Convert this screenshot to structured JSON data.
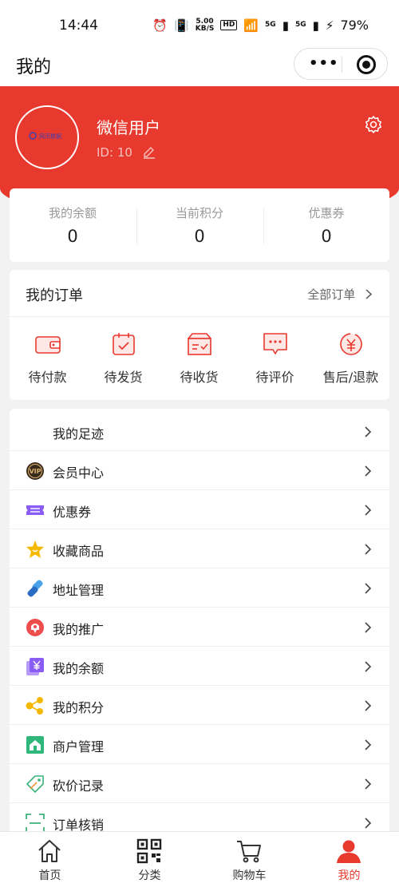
{
  "status_bar": {
    "time": "14:44",
    "net_speed_top": "5.00",
    "net_speed_bottom": "KB/S",
    "hd": "HD",
    "signal1": "5G",
    "signal2": "5G",
    "battery": "79%"
  },
  "nav": {
    "title": "我的",
    "menu_icon": "more-dots-icon",
    "close_icon": "target-icon"
  },
  "profile": {
    "name": "微信用户",
    "id_label": "ID:",
    "id_value": "10",
    "avatar_text": "网页数据",
    "accent_color": "#e8392f"
  },
  "balance": [
    {
      "label": "我的余额",
      "value": "0"
    },
    {
      "label": "当前积分",
      "value": "0"
    },
    {
      "label": "优惠券",
      "value": "0"
    }
  ],
  "orders": {
    "title": "我的订单",
    "all_label": "全部订单",
    "items": [
      {
        "label": "待付款",
        "icon": "wallet-icon"
      },
      {
        "label": "待发货",
        "icon": "calendar-check-icon"
      },
      {
        "label": "待收货",
        "icon": "box-icon"
      },
      {
        "label": "待评价",
        "icon": "comment-icon"
      },
      {
        "label": "售后/退款",
        "icon": "refund-icon"
      }
    ]
  },
  "menu": [
    {
      "label": "我的足迹",
      "icon": "footprint-icon"
    },
    {
      "label": "会员中心",
      "icon": "vip-icon"
    },
    {
      "label": "优惠券",
      "icon": "coupon-icon"
    },
    {
      "label": "收藏商品",
      "icon": "star-icon"
    },
    {
      "label": "地址管理",
      "icon": "address-icon"
    },
    {
      "label": "我的推广",
      "icon": "promotion-icon"
    },
    {
      "label": "我的余额",
      "icon": "yen-icon"
    },
    {
      "label": "我的积分",
      "icon": "points-icon"
    },
    {
      "label": "商户管理",
      "icon": "merchant-icon"
    },
    {
      "label": "砍价记录",
      "icon": "bargain-icon"
    },
    {
      "label": "订单核销",
      "icon": "scan-icon"
    }
  ],
  "tabbar": [
    {
      "label": "首页",
      "icon": "home-icon"
    },
    {
      "label": "分类",
      "icon": "qrcode-icon"
    },
    {
      "label": "购物车",
      "icon": "cart-icon"
    },
    {
      "label": "我的",
      "icon": "user-icon",
      "active": true
    }
  ]
}
